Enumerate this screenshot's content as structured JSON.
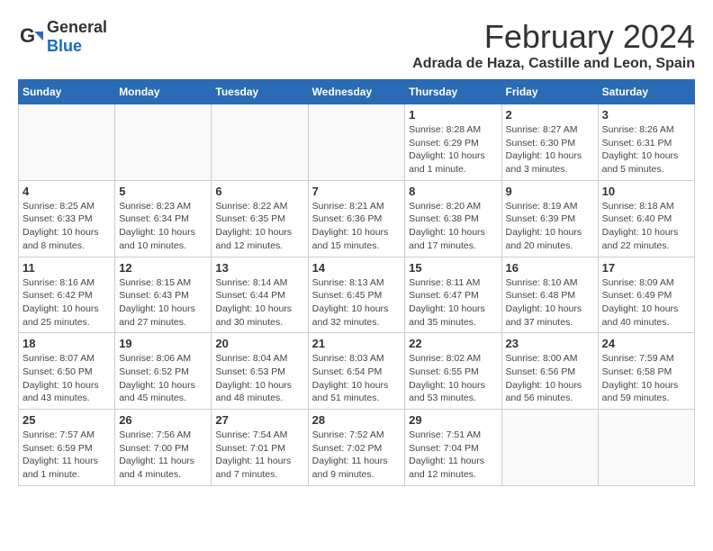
{
  "header": {
    "logo_general": "General",
    "logo_blue": "Blue",
    "title": "February 2024",
    "subtitle": "Adrada de Haza, Castille and Leon, Spain"
  },
  "weekdays": [
    "Sunday",
    "Monday",
    "Tuesday",
    "Wednesday",
    "Thursday",
    "Friday",
    "Saturday"
  ],
  "weeks": [
    [
      {
        "day": "",
        "info": ""
      },
      {
        "day": "",
        "info": ""
      },
      {
        "day": "",
        "info": ""
      },
      {
        "day": "",
        "info": ""
      },
      {
        "day": "1",
        "info": "Sunrise: 8:28 AM\nSunset: 6:29 PM\nDaylight: 10 hours and 1 minute."
      },
      {
        "day": "2",
        "info": "Sunrise: 8:27 AM\nSunset: 6:30 PM\nDaylight: 10 hours and 3 minutes."
      },
      {
        "day": "3",
        "info": "Sunrise: 8:26 AM\nSunset: 6:31 PM\nDaylight: 10 hours and 5 minutes."
      }
    ],
    [
      {
        "day": "4",
        "info": "Sunrise: 8:25 AM\nSunset: 6:33 PM\nDaylight: 10 hours and 8 minutes."
      },
      {
        "day": "5",
        "info": "Sunrise: 8:23 AM\nSunset: 6:34 PM\nDaylight: 10 hours and 10 minutes."
      },
      {
        "day": "6",
        "info": "Sunrise: 8:22 AM\nSunset: 6:35 PM\nDaylight: 10 hours and 12 minutes."
      },
      {
        "day": "7",
        "info": "Sunrise: 8:21 AM\nSunset: 6:36 PM\nDaylight: 10 hours and 15 minutes."
      },
      {
        "day": "8",
        "info": "Sunrise: 8:20 AM\nSunset: 6:38 PM\nDaylight: 10 hours and 17 minutes."
      },
      {
        "day": "9",
        "info": "Sunrise: 8:19 AM\nSunset: 6:39 PM\nDaylight: 10 hours and 20 minutes."
      },
      {
        "day": "10",
        "info": "Sunrise: 8:18 AM\nSunset: 6:40 PM\nDaylight: 10 hours and 22 minutes."
      }
    ],
    [
      {
        "day": "11",
        "info": "Sunrise: 8:16 AM\nSunset: 6:42 PM\nDaylight: 10 hours and 25 minutes."
      },
      {
        "day": "12",
        "info": "Sunrise: 8:15 AM\nSunset: 6:43 PM\nDaylight: 10 hours and 27 minutes."
      },
      {
        "day": "13",
        "info": "Sunrise: 8:14 AM\nSunset: 6:44 PM\nDaylight: 10 hours and 30 minutes."
      },
      {
        "day": "14",
        "info": "Sunrise: 8:13 AM\nSunset: 6:45 PM\nDaylight: 10 hours and 32 minutes."
      },
      {
        "day": "15",
        "info": "Sunrise: 8:11 AM\nSunset: 6:47 PM\nDaylight: 10 hours and 35 minutes."
      },
      {
        "day": "16",
        "info": "Sunrise: 8:10 AM\nSunset: 6:48 PM\nDaylight: 10 hours and 37 minutes."
      },
      {
        "day": "17",
        "info": "Sunrise: 8:09 AM\nSunset: 6:49 PM\nDaylight: 10 hours and 40 minutes."
      }
    ],
    [
      {
        "day": "18",
        "info": "Sunrise: 8:07 AM\nSunset: 6:50 PM\nDaylight: 10 hours and 43 minutes."
      },
      {
        "day": "19",
        "info": "Sunrise: 8:06 AM\nSunset: 6:52 PM\nDaylight: 10 hours and 45 minutes."
      },
      {
        "day": "20",
        "info": "Sunrise: 8:04 AM\nSunset: 6:53 PM\nDaylight: 10 hours and 48 minutes."
      },
      {
        "day": "21",
        "info": "Sunrise: 8:03 AM\nSunset: 6:54 PM\nDaylight: 10 hours and 51 minutes."
      },
      {
        "day": "22",
        "info": "Sunrise: 8:02 AM\nSunset: 6:55 PM\nDaylight: 10 hours and 53 minutes."
      },
      {
        "day": "23",
        "info": "Sunrise: 8:00 AM\nSunset: 6:56 PM\nDaylight: 10 hours and 56 minutes."
      },
      {
        "day": "24",
        "info": "Sunrise: 7:59 AM\nSunset: 6:58 PM\nDaylight: 10 hours and 59 minutes."
      }
    ],
    [
      {
        "day": "25",
        "info": "Sunrise: 7:57 AM\nSunset: 6:59 PM\nDaylight: 11 hours and 1 minute."
      },
      {
        "day": "26",
        "info": "Sunrise: 7:56 AM\nSunset: 7:00 PM\nDaylight: 11 hours and 4 minutes."
      },
      {
        "day": "27",
        "info": "Sunrise: 7:54 AM\nSunset: 7:01 PM\nDaylight: 11 hours and 7 minutes."
      },
      {
        "day": "28",
        "info": "Sunrise: 7:52 AM\nSunset: 7:02 PM\nDaylight: 11 hours and 9 minutes."
      },
      {
        "day": "29",
        "info": "Sunrise: 7:51 AM\nSunset: 7:04 PM\nDaylight: 11 hours and 12 minutes."
      },
      {
        "day": "",
        "info": ""
      },
      {
        "day": "",
        "info": ""
      }
    ]
  ]
}
